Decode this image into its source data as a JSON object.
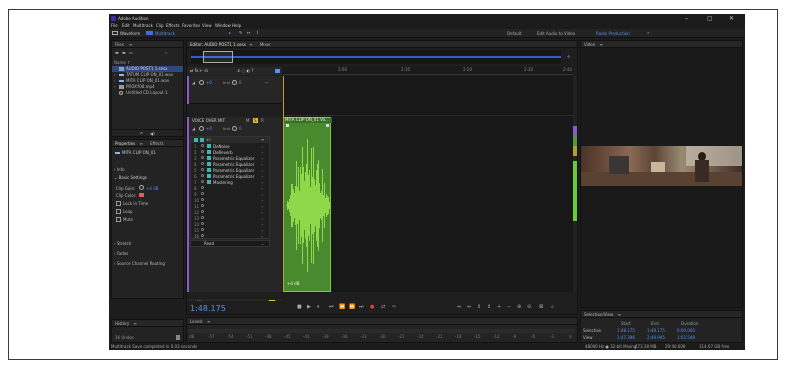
{
  "app": {
    "title": "Adobe Audition",
    "controls": [
      "–",
      "▢",
      "✕"
    ]
  },
  "menu": [
    "File",
    "Edit",
    "Multitrack",
    "Clip",
    "Effects",
    "Favorites",
    "View",
    "Window",
    "Help"
  ],
  "toolbar": {
    "waveform_label": "Waveform",
    "multitrack_label": "Multitrack",
    "workspaces": [
      "Default",
      "Edit Audio to Video",
      "Radio Production"
    ],
    "workspace_extra": "»"
  },
  "files_panel": {
    "title": "Files",
    "menu": "≡",
    "name_col": "Name ↑",
    "items": [
      {
        "label": "AUDIO POST1 1.sesx",
        "selected": true,
        "arrow": ""
      },
      {
        "label": "TATUM CLIP ON_01.wav",
        "selected": false,
        "arrow": "›"
      },
      {
        "label": "MITA CLIP ON_01.wav",
        "selected": false,
        "arrow": "›"
      },
      {
        "label": "PROXY08.mp4",
        "selected": false,
        "arrow": "›"
      },
      {
        "label": "Untitled CD Layout 1",
        "selected": false,
        "arrow": ""
      }
    ]
  },
  "properties_panel": {
    "tabs": [
      "Properties",
      "Effects"
    ],
    "menu": "≡",
    "clip_name": "MITA CLIP ON_01",
    "sections": [
      {
        "label": "Info",
        "open": false
      },
      {
        "label": "Basic Settings",
        "open": true
      }
    ],
    "clip_gain_label": "Clip Gain:",
    "clip_gain_value": "+4 dB",
    "clip_color_label": "Clip Color:",
    "checkboxes": [
      "Lock in Time",
      "Loop",
      "Mute"
    ],
    "collapsed": [
      "Stretch",
      "Fades",
      "Source Channel Routing"
    ]
  },
  "history_panel": {
    "title": "History",
    "menu": "≡",
    "undos": "16 Undos"
  },
  "editor": {
    "tab": "Editor: AUDIO POST1 1.sesx",
    "mixer_tab": "Mixer",
    "ruler": [
      "2:00",
      "2:10",
      "2:20",
      "2:30",
      "2:40"
    ],
    "track1_volume": "+0",
    "track1_pan": "0",
    "track2_name": "VOICE OVER MIT",
    "track2_volume": "+0",
    "track2_pan": "0",
    "track_modes": [
      "M",
      "S",
      "R"
    ],
    "clip_title": "MITA CLIP ON_01 Vo...",
    "clip_gain_badge": "+4 dB",
    "effects_rack": [
      "DeNoise",
      "DeReverb",
      "Parametric Equalizer",
      "Parametric Equalizer",
      "Parametric Equalizer",
      "Parametric Equalizer",
      "Mastering",
      "",
      "",
      "",
      "",
      "",
      "",
      "",
      "",
      ""
    ],
    "rack_numbers": [
      "1",
      "2",
      "3",
      "4",
      "5",
      "6",
      "7",
      "8",
      "9",
      "10",
      "11",
      "12",
      "13",
      "14",
      "15",
      "16"
    ],
    "read_mode": "Read",
    "mix_label": "Mix",
    "timecode": "1:48.175",
    "transport": [
      "■",
      "▶",
      "⏸",
      "⏮",
      "⏪",
      "⏩",
      "⏭",
      "●",
      "⇄",
      "⇨"
    ],
    "zoom_tools": [
      "⇔",
      "⇔",
      "⇕",
      "⇕",
      "+",
      "−",
      "⊕",
      "⊖",
      "⊠",
      "⌕"
    ]
  },
  "video_panel": {
    "title": "Video",
    "menu": "≡"
  },
  "levels_panel": {
    "title": "Levels",
    "menu": "≡",
    "scale": [
      "dB",
      "-57",
      "-54",
      "-51",
      "-48",
      "-45",
      "-42",
      "-39",
      "-36",
      "-33",
      "-30",
      "-27",
      "-24",
      "-21",
      "-18",
      "-15",
      "-12",
      "-9",
      "-6",
      "-3",
      "0"
    ]
  },
  "selection_panel": {
    "title": "Selection/View",
    "menu": "≡",
    "headers": [
      "Start",
      "End",
      "Duration"
    ],
    "rows": [
      {
        "label": "Selection",
        "start": "1:48.175",
        "end": "1:48.175",
        "duration": "0:00.000"
      },
      {
        "label": "View",
        "start": "1:47.396",
        "end": "2:49.945",
        "duration": "1:02.548"
      }
    ]
  },
  "status": {
    "left": "Multitrack Save completed in 0.03 seconds",
    "right": [
      "48000 Hz ● 32-bit Mixing",
      "473.38 MB",
      "29:40.609",
      "114.67 GB free"
    ]
  },
  "colors": {
    "accent": "#5a8ff0",
    "wave": "#8ed84a",
    "clip": "#4a8a2f",
    "playhead": "#c8a020"
  }
}
